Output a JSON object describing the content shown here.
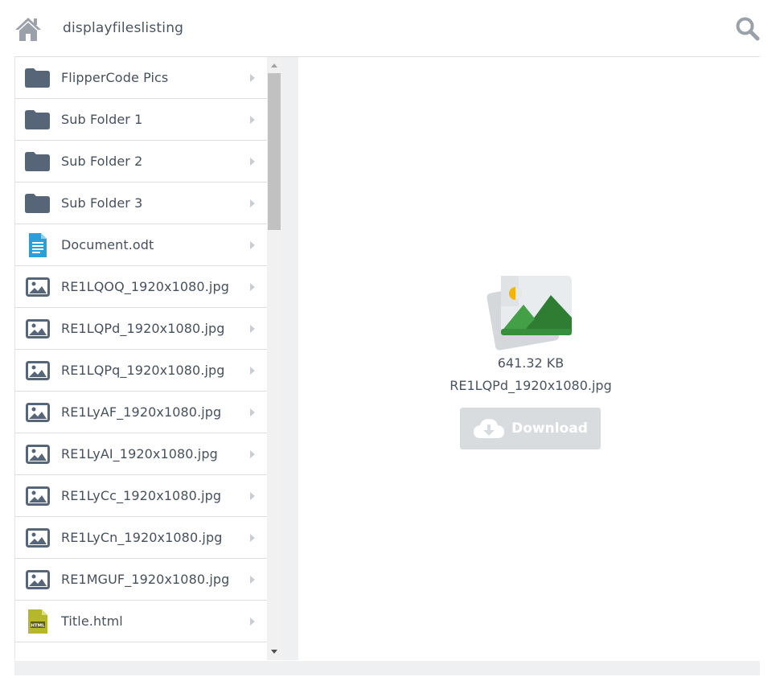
{
  "header": {
    "title": "displayfileslisting",
    "home_icon": "home-icon",
    "search_icon": "search-icon"
  },
  "items": [
    {
      "label": "FlipperCode Pics",
      "icon": "folder-icon"
    },
    {
      "label": "Sub Folder 1",
      "icon": "folder-icon"
    },
    {
      "label": "Sub Folder 2",
      "icon": "folder-icon"
    },
    {
      "label": "Sub Folder 3",
      "icon": "folder-icon"
    },
    {
      "label": "Document.odt",
      "icon": "document-icon"
    },
    {
      "label": "RE1LQOQ_1920x1080.jpg",
      "icon": "image-icon"
    },
    {
      "label": "RE1LQPd_1920x1080.jpg",
      "icon": "image-icon"
    },
    {
      "label": "RE1LQPq_1920x1080.jpg",
      "icon": "image-icon"
    },
    {
      "label": "RE1LyAF_1920x1080.jpg",
      "icon": "image-icon"
    },
    {
      "label": "RE1LyAI_1920x1080.jpg",
      "icon": "image-icon"
    },
    {
      "label": "RE1LyCc_1920x1080.jpg",
      "icon": "image-icon"
    },
    {
      "label": "RE1LyCn_1920x1080.jpg",
      "icon": "image-icon"
    },
    {
      "label": "RE1MGUF_1920x1080.jpg",
      "icon": "image-icon"
    },
    {
      "label": "Title.html",
      "icon": "html-file-icon"
    }
  ],
  "preview": {
    "size": "641.32 KB",
    "filename": "RE1LQPd_1920x1080.jpg",
    "download_label": "Download"
  },
  "colors": {
    "folder": "#566678",
    "document": "#2a9fd8",
    "html_badge": "#b5b82a",
    "image_green": "#43a047",
    "download_bg": "#d9dcdf"
  }
}
